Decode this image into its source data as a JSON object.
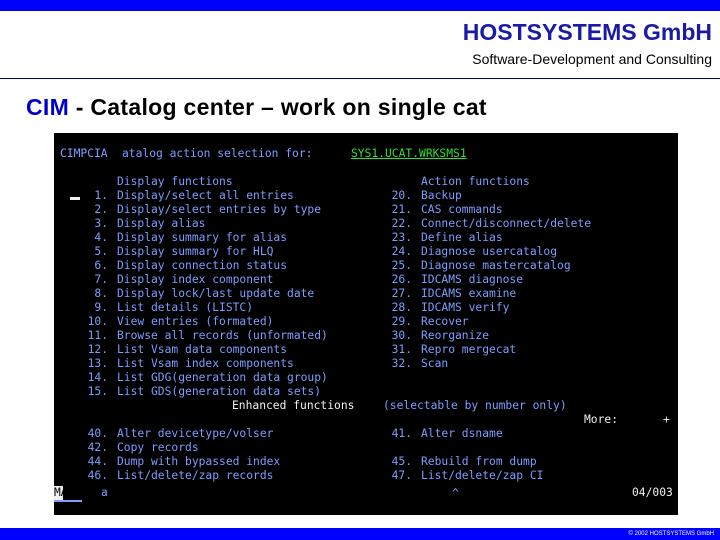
{
  "header": {
    "company": "HOSTSYSTEMS GmbH",
    "tagline": "Software-Development and Consulting"
  },
  "slide": {
    "title_acronym": "CIM",
    "title_rest": " - Catalog center – work on single cat"
  },
  "terminal": {
    "panel_id": "CIMPCIA",
    "prompt_text": "atalog action selection for:",
    "catalog_name": "SYS1.UCAT.WRKSMS1",
    "left_heading": "Display functions",
    "right_heading": "Action functions",
    "left_functions": [
      {
        "num": "1.",
        "label": "Display/select all entries"
      },
      {
        "num": "2.",
        "label": "Display/select entries by type"
      },
      {
        "num": "3.",
        "label": "Display alias"
      },
      {
        "num": "4.",
        "label": "Display summary for alias"
      },
      {
        "num": "5.",
        "label": "Display summary for HLQ"
      },
      {
        "num": "6.",
        "label": "Display connection status"
      },
      {
        "num": "7.",
        "label": "Display index component"
      },
      {
        "num": "8.",
        "label": "Display lock/last update date"
      },
      {
        "num": "9.",
        "label": "List details (LISTC)"
      },
      {
        "num": "10.",
        "label": "View entries (formated)"
      },
      {
        "num": "11.",
        "label": "Browse all records (unformated)"
      },
      {
        "num": "12.",
        "label": "List Vsam data components"
      },
      {
        "num": "13.",
        "label": "List Vsam index components"
      },
      {
        "num": "14.",
        "label": "List GDG(generation data group)"
      },
      {
        "num": "15.",
        "label": "List GDS(generation data sets)"
      }
    ],
    "right_functions": [
      {
        "num": "20.",
        "label": "Backup"
      },
      {
        "num": "21.",
        "label": "CAS commands"
      },
      {
        "num": "22.",
        "label": "Connect/disconnect/delete"
      },
      {
        "num": "23.",
        "label": "Define alias"
      },
      {
        "num": "24.",
        "label": "Diagnose usercatalog"
      },
      {
        "num": "25.",
        "label": "Diagnose mastercatalog"
      },
      {
        "num": "26.",
        "label": "IDCAMS diagnose"
      },
      {
        "num": "27.",
        "label": "IDCAMS examine"
      },
      {
        "num": "28.",
        "label": "IDCAMS verify"
      },
      {
        "num": "29.",
        "label": "Recover"
      },
      {
        "num": "30.",
        "label": "Reorganize"
      },
      {
        "num": "31.",
        "label": "Repro mergecat"
      },
      {
        "num": "32.",
        "label": "Scan"
      }
    ],
    "enhanced_heading": "Enhanced functions",
    "enhanced_hint": "(selectable by number only)",
    "more_label": "More:",
    "more_symbol": "+",
    "enhanced_left": [
      {
        "num": "40.",
        "label": "Alter devicetype/volser"
      },
      {
        "num": "42.",
        "label": "Copy records"
      },
      {
        "num": "44.",
        "label": "Dump with bypassed index"
      },
      {
        "num": "46.",
        "label": "List/delete/zap records"
      }
    ],
    "enhanced_right": [
      {
        "num": "41.",
        "label": "Alter dsname"
      },
      {
        "num": "45.",
        "label": "Rebuild from dump"
      },
      {
        "num": "47.",
        "label": "List/delete/zap CI"
      }
    ],
    "status_line": {
      "mode": "MA",
      "command": "a",
      "caret": "^",
      "position": "04/003"
    }
  },
  "footer": {
    "copyright": "© 2002 HOSTSYSTEMS GmbH"
  },
  "colors": {
    "accent_bar": "#0000ff",
    "title_acronym": "#0000cc",
    "terminal_text": "#7f9cff",
    "terminal_field": "#30e030",
    "terminal_bg": "#000000"
  }
}
